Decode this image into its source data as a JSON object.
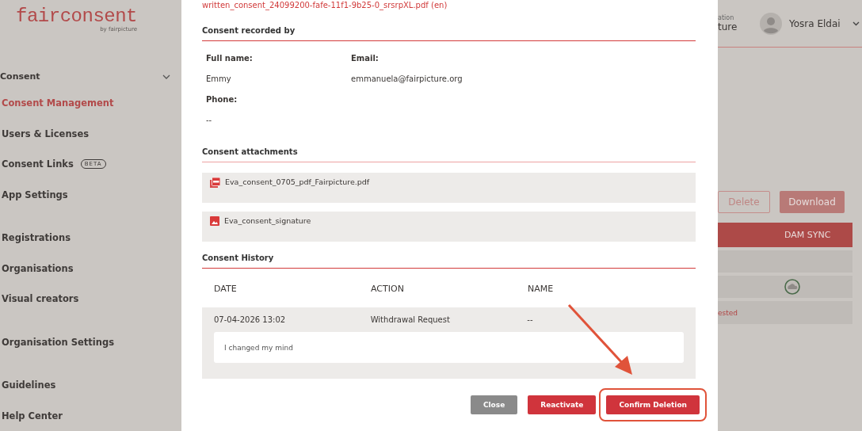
{
  "sidebar": {
    "logo": {
      "name": "fairconsent",
      "tagline": "by fairpicture"
    },
    "heading": {
      "label": "Consent",
      "expanded": true
    },
    "groups": [
      {
        "items": [
          {
            "label": "Consent Management",
            "selected": true
          },
          {
            "label": "Users & Licenses",
            "selected": false
          },
          {
            "label": "Consent Links",
            "selected": false,
            "badge": "BETA"
          },
          {
            "label": "App Settings",
            "selected": false
          }
        ]
      },
      {
        "items": [
          {
            "label": "Registrations",
            "selected": false
          },
          {
            "label": "Organisations",
            "selected": false
          },
          {
            "label": "Visual creators",
            "selected": false
          }
        ]
      },
      {
        "items": [
          {
            "label": "Organisation Settings",
            "selected": false
          }
        ]
      },
      {
        "items": [
          {
            "label": "Guidelines",
            "selected": false
          },
          {
            "label": "Help Center",
            "selected": false
          }
        ]
      }
    ]
  },
  "header": {
    "organisation_label": "ation",
    "organisation_name": "ture",
    "user_name": "Yosra Eldai"
  },
  "background_panel": {
    "buttons": [
      {
        "label": "Delete",
        "kind": "outline"
      },
      {
        "label": "Download",
        "kind": "filled"
      }
    ],
    "table_heading": "DAM SYNC",
    "rows": [
      {
        "kind": "blank"
      },
      {
        "kind": "synced"
      },
      {
        "kind": "status",
        "text": "ested"
      }
    ]
  },
  "modal": {
    "file_link": "written_consent_24099200-fafe-11f1-9b25-0_srsrpXL.pdf (en)",
    "recorded_by": {
      "heading": "Consent recorded by",
      "fields": [
        {
          "label": "Full name:",
          "value": "Emmy"
        },
        {
          "label": "Email:",
          "value": "emmanuela@fairpicture.org"
        },
        {
          "label": "Phone:",
          "value": "--"
        }
      ]
    },
    "attachments": {
      "heading": "Consent attachments",
      "items": [
        {
          "kind": "pdf",
          "name": "Eva_consent_0705_pdf_Fairpicture.pdf"
        },
        {
          "kind": "image",
          "name": "Eva_consent_signature"
        }
      ]
    },
    "history": {
      "heading": "Consent History",
      "columns": [
        "DATE",
        "ACTION",
        "NAME"
      ],
      "rows": [
        {
          "date": "07-04-2026 13:02",
          "action": "Withdrawal Request",
          "name": "--",
          "comment": "I changed my mind"
        }
      ]
    },
    "buttons": [
      {
        "label": "Close",
        "kind": "neutral",
        "highlighted": false
      },
      {
        "label": "Reactivate",
        "kind": "danger",
        "highlighted": false
      },
      {
        "label": "Confirm Deletion",
        "kind": "danger",
        "highlighted": true
      }
    ]
  }
}
